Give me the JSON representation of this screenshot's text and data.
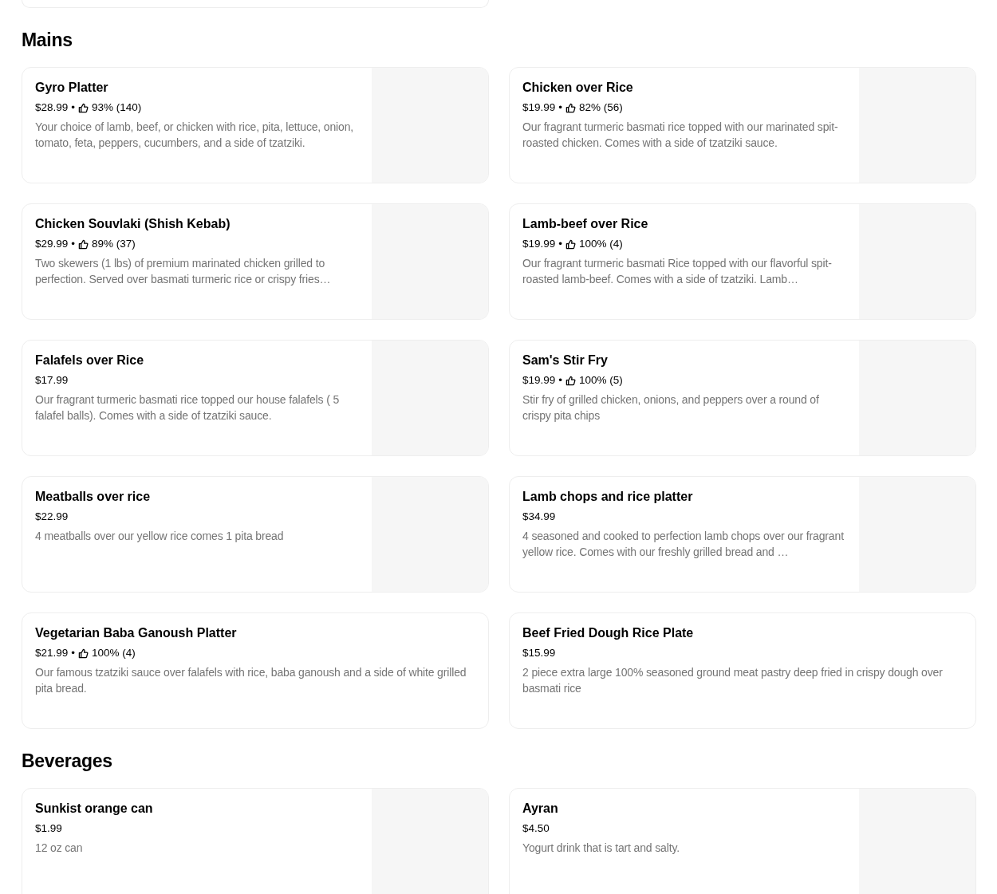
{
  "sections": [
    {
      "title": "Mains",
      "items": [
        {
          "name": "Gyro Platter",
          "price": "$28.99",
          "rating": {
            "separator": "•",
            "text": "93% (140)"
          },
          "description": "Your choice of lamb, beef, or chicken with rice, pita, lettuce, onion, tomato, feta, peppers, cucumbers, and a side of tzatziki.",
          "image": true
        },
        {
          "name": "Chicken over Rice",
          "price": "$19.99",
          "rating": {
            "separator": "•",
            "text": "82% (56)"
          },
          "description": "Our fragrant turmeric basmati rice topped with our marinated spit-roasted chicken. Comes with a side of tzatziki sauce.",
          "image": true
        },
        {
          "name": "Chicken Souvlaki (Shish Kebab)",
          "price": "$29.99",
          "rating": {
            "separator": "•",
            "text": "89% (37)"
          },
          "description": "Two skewers (1 lbs) of premium marinated chicken grilled to perfection. Served over basmati turmeric rice or crispy fries…",
          "image": true
        },
        {
          "name": "Lamb-beef over Rice",
          "price": "$19.99",
          "rating": {
            "separator": "•",
            "text": "100% (4)"
          },
          "description": "Our fragrant turmeric basmati Rice topped with our flavorful spit-roasted lamb-beef. Comes with a side of tzatziki. Lamb…",
          "image": true
        },
        {
          "name": "Falafels over Rice",
          "price": "$17.99",
          "description": "Our fragrant turmeric basmati rice topped our house falafels ( 5 falafel balls). Comes with a side of tzatziki sauce.",
          "image": true
        },
        {
          "name": "Sam's Stir Fry",
          "price": "$19.99",
          "rating": {
            "separator": "•",
            "text": "100% (5)"
          },
          "description": "Stir fry of grilled chicken, onions, and peppers over a round of crispy pita chips",
          "image": true
        },
        {
          "name": "Meatballs over rice",
          "price": "$22.99",
          "description": "4 meatballs over our yellow rice comes 1 pita bread",
          "image": true
        },
        {
          "name": "Lamb chops and rice platter",
          "price": "$34.99",
          "description": "4 seasoned and cooked to perfection lamb chops over our fragrant yellow rice. Comes with our freshly grilled bread and …",
          "image": true
        },
        {
          "name": "Vegetarian Baba Ganoush Platter",
          "price": "$21.99",
          "rating": {
            "separator": "•",
            "text": "100% (4)"
          },
          "description": "Our famous tzatziki sauce over falafels with rice, baba ganoush and a side of white grilled pita bread.",
          "image": false
        },
        {
          "name": "Beef Fried Dough Rice Plate",
          "price": "$15.99",
          "description": "2 piece extra large 100% seasoned ground meat pastry deep fried in crispy dough over basmati rice",
          "image": false
        }
      ]
    },
    {
      "title": "Beverages",
      "items": [
        {
          "name": "Sunkist orange can",
          "price": "$1.99",
          "description": "12 oz can",
          "image": true
        },
        {
          "name": "Ayran",
          "price": "$4.50",
          "description": "Yogurt drink that is tart and salty.",
          "image": true
        }
      ]
    }
  ]
}
